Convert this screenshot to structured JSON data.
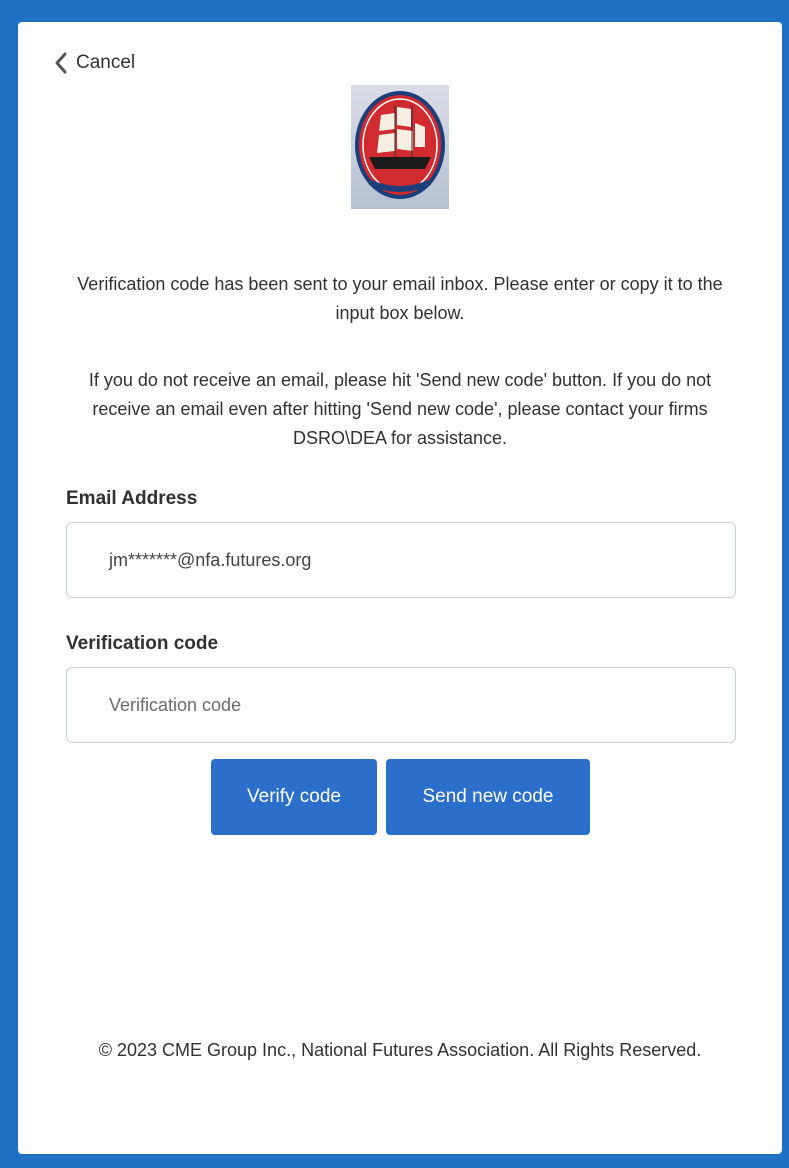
{
  "colors": {
    "frame": "#1f6fc2",
    "button": "#2b6fca",
    "card": "#ffffff",
    "logo_red": "#d12a2f"
  },
  "header": {
    "cancel_icon": "chevron-left-icon",
    "cancel_label": "Cancel"
  },
  "logo": {
    "icon": "ship-seal-logo"
  },
  "messages": {
    "line1": "Verification code has been sent to your email inbox. Please enter or copy it to the input box below.",
    "line2": "If you do not receive an email, please hit 'Send new code' button. If you do not receive an email even after hitting 'Send new code', please contact your firms DSRO\\DEA for assistance."
  },
  "form": {
    "email_label": "Email Address",
    "email_value": "jm*******@nfa.futures.org",
    "code_label": "Verification code",
    "code_placeholder": "Verification code",
    "code_value": ""
  },
  "buttons": {
    "verify_label": "Verify code",
    "send_label": "Send new code"
  },
  "footer": {
    "copyright": "© 2023 CME Group Inc., National Futures Association. All Rights Reserved."
  }
}
